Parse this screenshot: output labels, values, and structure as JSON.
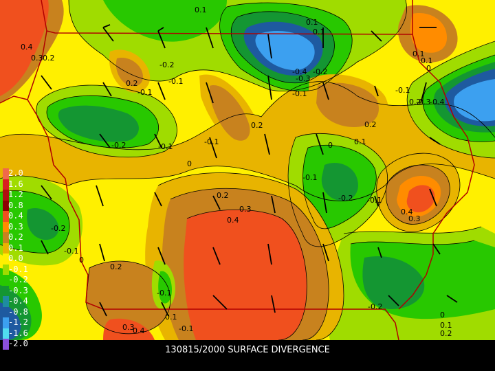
{
  "caption": "130815/2000 SURFACE DIVERGENCE",
  "legend": [
    {
      "label": "2.0",
      "color": "#f06a4a"
    },
    {
      "label": "1.6",
      "color": "#d92020"
    },
    {
      "label": "1.2",
      "color": "#b01010"
    },
    {
      "label": "0.8",
      "color": "#8c0000"
    },
    {
      "label": "0.4",
      "color": "#f0501e"
    },
    {
      "label": "0.3",
      "color": "#ff8c00"
    },
    {
      "label": "0.2",
      "color": "#c8821e"
    },
    {
      "label": "0.1",
      "color": "#e8b400"
    },
    {
      "label": "0.0",
      "color": "#fff000"
    },
    {
      "label": "-0.1",
      "color": "#a0dc00"
    },
    {
      "label": "-0.2",
      "color": "#28c800"
    },
    {
      "label": "-0.3",
      "color": "#149632"
    },
    {
      "label": "-0.4",
      "color": "#1e8ca0"
    },
    {
      "label": "-0.8",
      "color": "#1e5aa0"
    },
    {
      "label": "-1.2",
      "color": "#3ca0f0"
    },
    {
      "label": "-1.6",
      "color": "#50dcf0"
    },
    {
      "label": "-2.0",
      "color": "#8c50dc"
    }
  ],
  "contour_labels": [
    "0.4",
    "0.3",
    "0.2",
    "0.1",
    "0.1",
    "0.1",
    "-0.2",
    "-0.1",
    "0.2",
    "-0.1",
    "-0.4",
    "-0.3",
    "-0.2",
    "-0.1",
    "-0.1",
    "0.1",
    "0",
    "0.1",
    "0.2",
    "-0.3",
    "-0.4",
    "0.2",
    "-0.1",
    "0",
    "-0.2",
    "-0.1",
    "0.1",
    "0",
    "0.2",
    "0.3",
    "0.4",
    "-0.1",
    "-0.2",
    "0.4",
    "0.3",
    "0.2",
    "-0.2",
    "-0.1",
    "0",
    "0.2",
    "-0.1",
    "0.1",
    "0.3",
    "0.4",
    "-0.1",
    "-0.2",
    "0",
    "0.1",
    "0.2",
    "-0.1"
  ]
}
